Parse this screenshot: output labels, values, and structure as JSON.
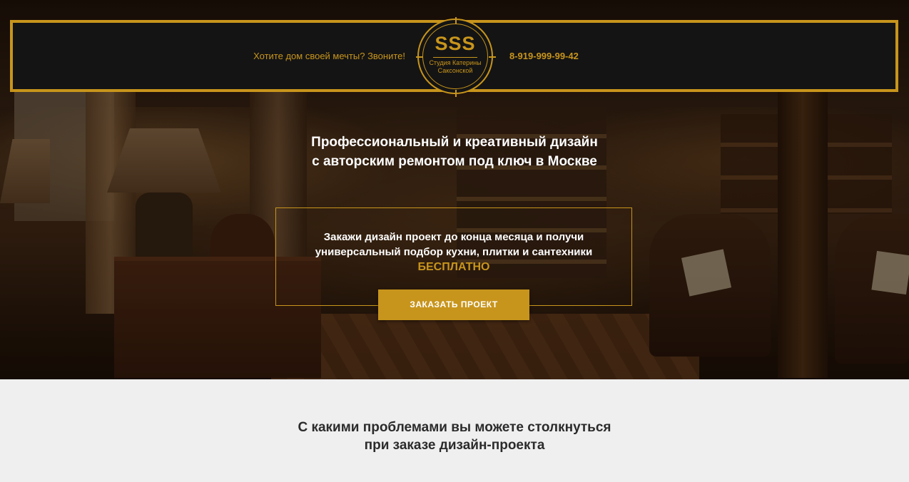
{
  "header": {
    "tagline": "Хотите дом своей мечты? Звоните!",
    "phone": "8-919-999-99-42",
    "logo": {
      "monogram": "SSS",
      "line1": "Студия Катерины",
      "line2": "Саксонской"
    }
  },
  "hero": {
    "title_line1": "Профессиональный и креативный дизайн",
    "title_line2": "с авторским ремонтом под ключ в Москве",
    "offer_line1": "Закажи дизайн проект до конца месяца и получи",
    "offer_line2": "универсальный подбор кухни, плитки и сантехники",
    "offer_free": "БЕСПЛАТНО",
    "button_label": "ЗАКАЗАТЬ ПРОЕКТ"
  },
  "section2": {
    "title_line1": "С какими проблемами вы можете столкнуться",
    "title_line2": "при заказе дизайн-проекта"
  },
  "colors": {
    "accent": "#c8951c",
    "header_bg": "#141414",
    "section_bg": "#efefef"
  }
}
